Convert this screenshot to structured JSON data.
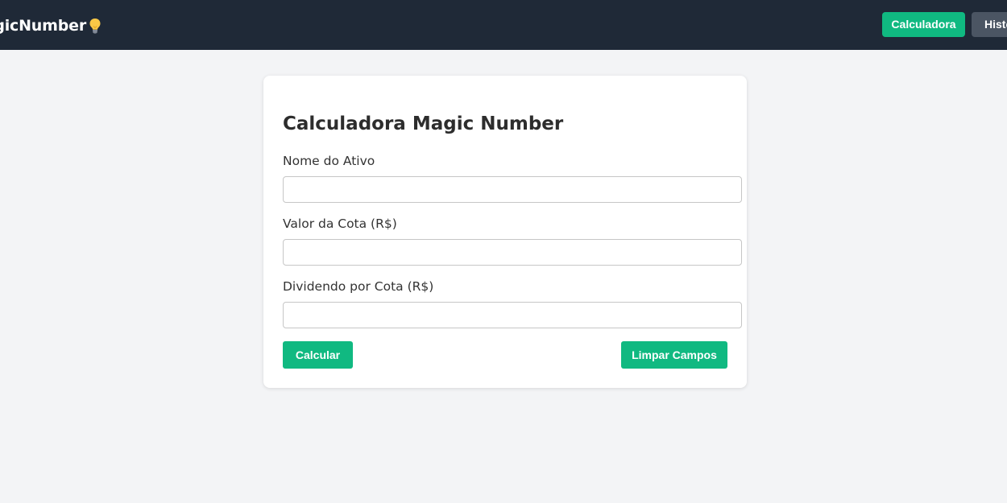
{
  "header": {
    "brand_text": "MagicNumber",
    "brand_icon": "lightbulb-icon",
    "nav": {
      "calculator_label": "Calculadora",
      "history_label": "Histórico"
    }
  },
  "calculator": {
    "title": "Calculadora Magic Number",
    "fields": {
      "asset_name": {
        "label": "Nome do Ativo",
        "value": "",
        "placeholder": ""
      },
      "share_price": {
        "label": "Valor da Cota (R$)",
        "value": "",
        "placeholder": ""
      },
      "dividend_per_share": {
        "label": "Dividendo por Cota (R$)",
        "value": "",
        "placeholder": ""
      }
    },
    "buttons": {
      "calculate_label": "Calcular",
      "clear_label": "Limpar Campos"
    }
  },
  "colors": {
    "header_bg": "#1f2937",
    "accent": "#10b981",
    "secondary_button": "#4b5563",
    "page_bg": "#f3f4f6"
  }
}
